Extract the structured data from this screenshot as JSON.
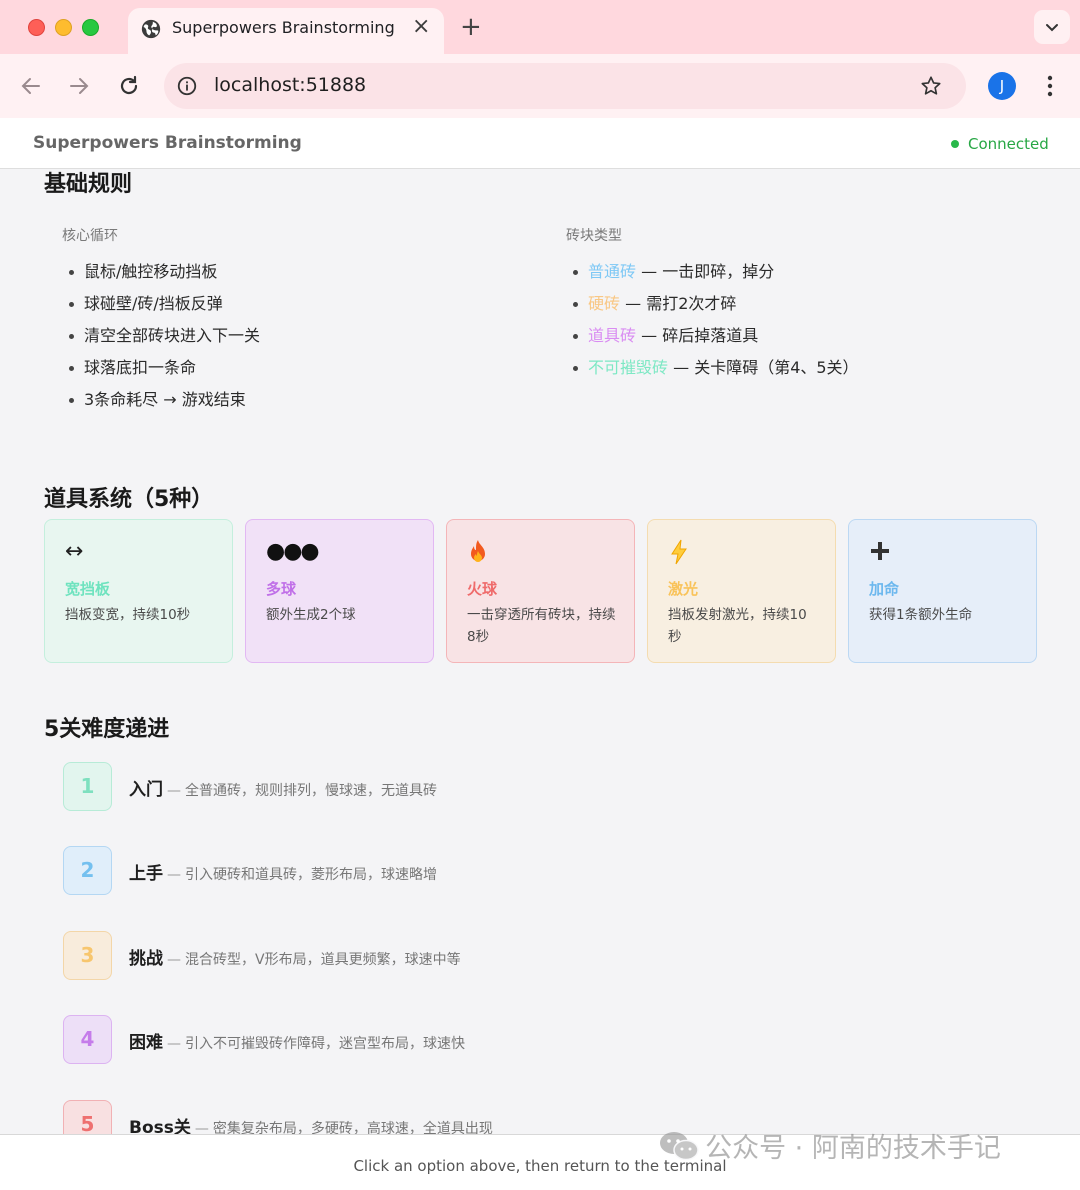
{
  "browser": {
    "tab_title": "Superpowers Brainstorming",
    "url": "localhost:51888",
    "profile_initial": "J"
  },
  "header": {
    "title": "Superpowers Brainstorming",
    "status": "Connected",
    "status_color": "#28a745"
  },
  "basic_rules": {
    "title": "基础规则",
    "core_loop": {
      "label": "核心循环",
      "items": [
        "鼠标/触控移动挡板",
        "球碰壁/砖/挡板反弹",
        "清空全部砖块进入下一关",
        "球落底扣一条命",
        "3条命耗尽 → 游戏结束"
      ]
    },
    "brick_types": {
      "label": "砖块类型",
      "items": [
        {
          "name": "普通砖",
          "desc": " — 一击即碎，掉分",
          "color": "#7ec8f5"
        },
        {
          "name": "硬砖",
          "desc": " — 需打2次才碎",
          "color": "#f9c784"
        },
        {
          "name": "道具砖",
          "desc": " — 碎后掉落道具",
          "color": "#d98cf2"
        },
        {
          "name": "不可摧毁砖",
          "desc": " — 关卡障碍（第4、5关）",
          "color": "#7de8c4"
        }
      ]
    }
  },
  "powerups": {
    "title": "道具系统（5种）",
    "items": [
      {
        "icon": "double-arrow-icon",
        "glyph": "↔",
        "name": "宽挡板",
        "desc": "挡板变宽，持续10秒",
        "color": "#6fe3bf",
        "bg": "#e8f6f0",
        "border": "#c4efdd"
      },
      {
        "icon": "three-balls-icon",
        "glyph": "●●●",
        "name": "多球",
        "desc": "额外生成2个球",
        "color": "#c070e8",
        "bg": "#f1e1f7",
        "border": "#e2b8f3"
      },
      {
        "icon": "fire-icon",
        "glyph": "🔥",
        "name": "火球",
        "desc": "一击穿透所有砖块，持续8秒",
        "color": "#ef6b6b",
        "bg": "#f8e3e5",
        "border": "#f4b5b8"
      },
      {
        "icon": "lightning-icon",
        "glyph": "⚡",
        "name": "激光",
        "desc": "挡板发射激光，持续10秒",
        "color": "#f9c35a",
        "bg": "#f8efe1",
        "border": "#f4dcb0"
      },
      {
        "icon": "plus-icon",
        "glyph": "✚",
        "name": "加命",
        "desc": "获得1条额外生命",
        "color": "#6db8ee",
        "bg": "#e6eef9",
        "border": "#bcd8f3"
      }
    ]
  },
  "levels": {
    "title": "5关难度递进",
    "items": [
      {
        "num": "1",
        "name": "入门",
        "desc": "全普通砖，规则排列，慢球速，无道具砖",
        "color": "#7ee0bf",
        "bg": "#e2f5ee",
        "border": "#b7ebd7"
      },
      {
        "num": "2",
        "name": "上手",
        "desc": "引入硬砖和道具砖，菱形布局，球速略增",
        "color": "#74c0ef",
        "bg": "#e0eefa",
        "border": "#b4d7f3"
      },
      {
        "num": "3",
        "name": "挑战",
        "desc": "混合砖型，V形布局，道具更频繁，球速中等",
        "color": "#f7c66e",
        "bg": "#f8ecdc",
        "border": "#f3d6a8"
      },
      {
        "num": "4",
        "name": "困难",
        "desc": "引入不可摧毁砖作障碍，迷宫型布局，球速快",
        "color": "#c57cea",
        "bg": "#eddff7",
        "border": "#dcb3f1"
      },
      {
        "num": "5",
        "name": "Boss关",
        "desc": "密集复杂布局，多硬砖，高球速，全道具出现",
        "color": "#ee7070",
        "bg": "#f8e0e1",
        "border": "#f1b1b4"
      }
    ]
  },
  "footer": {
    "text": "Click an option above, then return to the terminal"
  },
  "watermark": {
    "text": "公众号 · 阿南的技术手记"
  }
}
